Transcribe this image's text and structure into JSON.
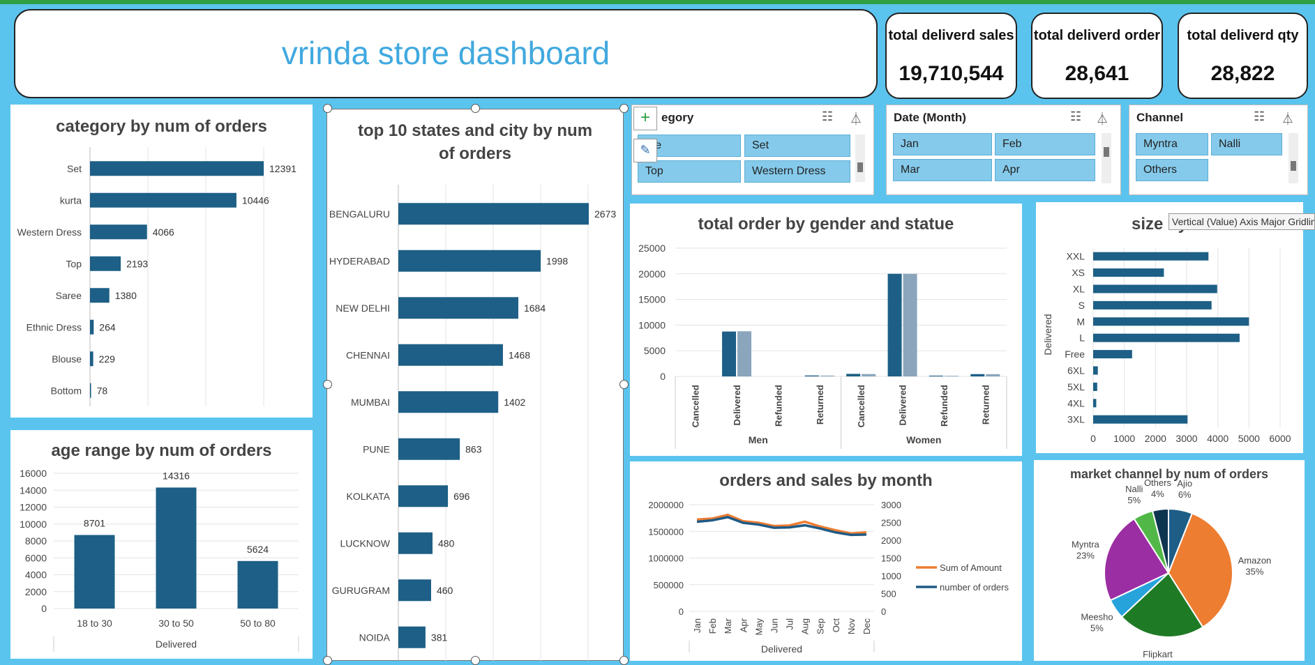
{
  "title": "vrinda store dashboard",
  "kpis": [
    {
      "label": "total deliverd sales",
      "value": "19,710,544"
    },
    {
      "label": "total deliverd order",
      "value": "28,641"
    },
    {
      "label": "total deliverd qty",
      "value": "28,822"
    }
  ],
  "slicers": {
    "category": {
      "title": "Category",
      "visible_title": "egory",
      "items": [
        "Saree",
        "Set",
        "Top",
        "Western Dress"
      ],
      "visible_first_item": "ree"
    },
    "month": {
      "title": "Date (Month)",
      "items": [
        "Jan",
        "Feb",
        "Mar",
        "Apr"
      ]
    },
    "channel": {
      "title": "Channel",
      "items": [
        "Myntra",
        "Nalli",
        "Others"
      ]
    }
  },
  "tooltip": "Vertical (Value) Axis Major Gridlines  Plot Area",
  "colors": {
    "bar": "#1d5f86",
    "bar_light": "#8aa5bc",
    "line_orange": "#ed7d31",
    "line_blue": "#1f5a85",
    "background": "#5bc4ee"
  },
  "chart_data": [
    {
      "id": "category",
      "type": "bar",
      "orientation": "horizontal",
      "title": "category by num of orders",
      "categories": [
        "Set",
        "kurta",
        "Western Dress",
        "Top",
        "Saree",
        "Ethnic Dress",
        "Blouse",
        "Bottom"
      ],
      "values": [
        12391,
        10446,
        4066,
        2193,
        1380,
        264,
        229,
        78
      ]
    },
    {
      "id": "age",
      "type": "bar",
      "title": "age range by num of orders",
      "categories": [
        "18 to 30",
        "30 to 50",
        "50 to 80"
      ],
      "values": [
        8701,
        14316,
        5624
      ],
      "xlabel": "Delivered",
      "ylim": [
        0,
        16000
      ],
      "yticks": [
        "0",
        "2000",
        "4000",
        "6000",
        "8000",
        "10000",
        "12000",
        "14000",
        "16000"
      ]
    },
    {
      "id": "states",
      "type": "bar",
      "orientation": "horizontal",
      "title": "top 10 states and city by num of orders",
      "categories": [
        "BENGALURU",
        "HYDERABAD",
        "NEW DELHI",
        "CHENNAI",
        "MUMBAI",
        "PUNE",
        "KOLKATA",
        "LUCKNOW",
        "GURUGRAM",
        "NOIDA"
      ],
      "values": [
        2673,
        1998,
        1684,
        1468,
        1402,
        863,
        696,
        480,
        460,
        381
      ]
    },
    {
      "id": "gender",
      "type": "bar",
      "title": "total order by gender and statue",
      "groups": [
        "Men",
        "Women"
      ],
      "categories": [
        "Cancelled",
        "Delivered",
        "Refunded",
        "Returned"
      ],
      "series": [
        {
          "values": [
            [
              0,
              8750,
              0,
              180
            ],
            [
              500,
              20000,
              150,
              450
            ]
          ]
        },
        {
          "values": [
            [
              0,
              8800,
              0,
              160
            ],
            [
              460,
              20000,
              120,
              440
            ]
          ]
        }
      ],
      "ylim": [
        0,
        25000
      ],
      "yticks": [
        "0",
        "5000",
        "10000",
        "15000",
        "20000",
        "25000"
      ]
    },
    {
      "id": "size",
      "type": "bar",
      "orientation": "horizontal",
      "title": "size by nu",
      "ylabel": "Delivered",
      "categories": [
        "XXL",
        "XS",
        "XL",
        "S",
        "M",
        "L",
        "Free",
        "6XL",
        "5XL",
        "4XL",
        "3XL"
      ],
      "values": [
        3700,
        2270,
        3980,
        3800,
        5000,
        4700,
        1250,
        150,
        130,
        100,
        3030
      ],
      "xlim": [
        0,
        6000
      ],
      "xticks": [
        "0",
        "1000",
        "2000",
        "3000",
        "4000",
        "5000",
        "6000"
      ]
    },
    {
      "id": "monthly",
      "type": "line",
      "title": "orders and sales by month",
      "xlabel": "Delivered",
      "x": [
        "Jan",
        "Feb",
        "Mar",
        "Apr",
        "May",
        "Jun",
        "Jul",
        "Aug",
        "Sep",
        "Oct",
        "Nov",
        "Dec"
      ],
      "series": [
        {
          "name": "Sum of Amount",
          "axis": "left",
          "values": [
            1720000,
            1740000,
            1810000,
            1690000,
            1660000,
            1600000,
            1610000,
            1680000,
            1590000,
            1520000,
            1460000,
            1480000
          ]
        },
        {
          "name": "number of orders",
          "axis": "right",
          "values": [
            2520,
            2560,
            2650,
            2490,
            2440,
            2350,
            2360,
            2420,
            2330,
            2220,
            2150,
            2160
          ]
        }
      ],
      "ylim_left": [
        0,
        2000000
      ],
      "ylim_right": [
        0,
        3000
      ],
      "yticks_left": [
        "0",
        "500000",
        "1000000",
        "1500000",
        "2000000"
      ],
      "yticks_right": [
        "0",
        "500",
        "1000",
        "1500",
        "2000",
        "2500",
        "3000"
      ]
    },
    {
      "id": "channel",
      "type": "pie",
      "title": "market channel by num of orders",
      "slices": [
        {
          "label": "Ajio",
          "pct": "6%",
          "value": 6,
          "color": "#1e5d86"
        },
        {
          "label": "Amazon",
          "pct": "35%",
          "value": 35,
          "color": "#ed7d31"
        },
        {
          "label": "Flipkart",
          "pct": "22%",
          "value": 22,
          "color": "#1f7a26"
        },
        {
          "label": "Meesho",
          "pct": "5%",
          "value": 5,
          "color": "#27a3dc"
        },
        {
          "label": "Myntra",
          "pct": "23%",
          "value": 23,
          "color": "#9b2ea2"
        },
        {
          "label": "Nalli",
          "pct": "5%",
          "value": 5,
          "color": "#51b848"
        },
        {
          "label": "Others",
          "pct": "4%",
          "value": 4,
          "color": "#0e3550"
        }
      ]
    }
  ]
}
